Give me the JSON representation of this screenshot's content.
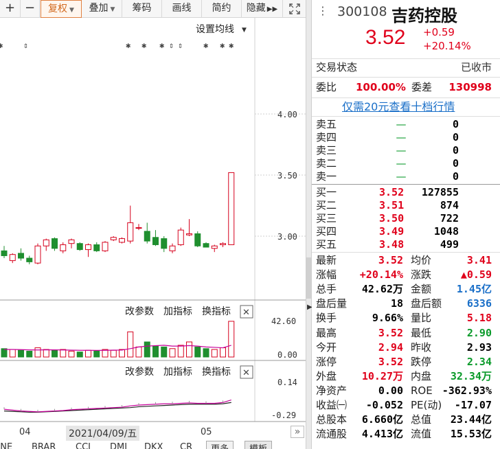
{
  "toolbar": {
    "zoom_in": "+",
    "zoom_out": "−",
    "fuquan": "复权",
    "diejia": "叠加",
    "chouma": "筹码",
    "huaxian": "画线",
    "jianyue": "简约",
    "yincang": "隐藏",
    "expand_icon": "expand-icon"
  },
  "chart": {
    "ma_setting": "设置均线",
    "price_ticks": [
      "4.00",
      "3.50",
      "3.00"
    ],
    "volume_ticks": [
      "42.60",
      "0.00"
    ],
    "indicator_ticks": [
      "0.14",
      "-0.29"
    ],
    "volume_panel_links": [
      "改参数",
      "加指标",
      "换指标"
    ],
    "indicator_panel_links": [
      "改参数",
      "加指标",
      "换指标"
    ],
    "close_glyph": "✕",
    "date_labels": [
      "04",
      "2021/04/09/五",
      "05"
    ],
    "colors": {
      "up": "#d6001c",
      "down": "#1f8f2f",
      "ma1": "#c6009a",
      "ma2": "#222222"
    }
  },
  "chart_data": {
    "type": "candlestick",
    "ylim": [
      2.55,
      4.15
    ],
    "candles": [
      {
        "o": 2.88,
        "h": 2.92,
        "l": 2.82,
        "c": 2.84
      },
      {
        "o": 2.8,
        "h": 2.86,
        "l": 2.78,
        "c": 2.85
      },
      {
        "o": 2.86,
        "h": 2.9,
        "l": 2.8,
        "c": 2.82
      },
      {
        "o": 2.82,
        "h": 2.84,
        "l": 2.77,
        "c": 2.79
      },
      {
        "o": 2.78,
        "h": 2.94,
        "l": 2.77,
        "c": 2.92
      },
      {
        "o": 2.92,
        "h": 2.98,
        "l": 2.88,
        "c": 2.97
      },
      {
        "o": 2.98,
        "h": 2.99,
        "l": 2.88,
        "c": 2.9
      },
      {
        "o": 2.88,
        "h": 2.95,
        "l": 2.86,
        "c": 2.93
      },
      {
        "o": 2.94,
        "h": 2.98,
        "l": 2.9,
        "c": 2.97
      },
      {
        "o": 2.94,
        "h": 2.95,
        "l": 2.88,
        "c": 2.89
      },
      {
        "o": 2.89,
        "h": 2.94,
        "l": 2.83,
        "c": 2.93
      },
      {
        "o": 2.93,
        "h": 2.95,
        "l": 2.87,
        "c": 2.88
      },
      {
        "o": 2.88,
        "h": 2.96,
        "l": 2.87,
        "c": 2.95
      },
      {
        "o": 2.97,
        "h": 3.0,
        "l": 2.96,
        "c": 2.99
      },
      {
        "o": 2.95,
        "h": 2.99,
        "l": 2.94,
        "c": 2.98
      },
      {
        "o": 2.96,
        "h": 3.25,
        "l": 2.94,
        "c": 3.11
      },
      {
        "o": 3.07,
        "h": 3.1,
        "l": 3.05,
        "c": 3.07
      },
      {
        "o": 3.04,
        "h": 3.11,
        "l": 2.94,
        "c": 2.96
      },
      {
        "o": 2.99,
        "h": 3.05,
        "l": 2.92,
        "c": 2.93
      },
      {
        "o": 2.98,
        "h": 3.0,
        "l": 2.87,
        "c": 2.9
      },
      {
        "o": 2.88,
        "h": 2.94,
        "l": 2.86,
        "c": 2.92
      },
      {
        "o": 2.93,
        "h": 3.07,
        "l": 2.92,
        "c": 3.05
      },
      {
        "o": 3.01,
        "h": 3.14,
        "l": 3.0,
        "c": 3.02
      },
      {
        "o": 3.02,
        "h": 3.04,
        "l": 2.91,
        "c": 2.92
      },
      {
        "o": 2.94,
        "h": 2.95,
        "l": 2.91,
        "c": 2.91
      },
      {
        "o": 2.9,
        "h": 2.93,
        "l": 2.87,
        "c": 2.92
      },
      {
        "o": 2.93,
        "h": 2.95,
        "l": 2.91,
        "c": 2.94
      },
      {
        "o": 2.93,
        "h": 3.52,
        "l": 2.93,
        "c": 3.52
      }
    ],
    "volume": {
      "ylim": [
        0,
        42.6
      ],
      "values": [
        10,
        9,
        8,
        7,
        11,
        9,
        8,
        9,
        7,
        6,
        8,
        7,
        9,
        8,
        9,
        30,
        12,
        18,
        13,
        12,
        10,
        14,
        18,
        12,
        10,
        9,
        11,
        42.62
      ],
      "ma": [
        9,
        9,
        8.8,
        8.5,
        8.4,
        8.6,
        8.5,
        8.4,
        8.2,
        8,
        8,
        7.9,
        8,
        8.2,
        8.3,
        10,
        12,
        13,
        13.5,
        14,
        13,
        13,
        13.6,
        13,
        12,
        11.5,
        11,
        14
      ]
    },
    "indicator": {
      "ylim": [
        -0.29,
        0.14
      ],
      "line1": [
        -0.21,
        -0.22,
        -0.23,
        -0.235,
        -0.24,
        -0.235,
        -0.23,
        -0.225,
        -0.215,
        -0.21,
        -0.205,
        -0.2,
        -0.195,
        -0.19,
        -0.185,
        -0.17,
        -0.16,
        -0.155,
        -0.15,
        -0.145,
        -0.145,
        -0.14,
        -0.135,
        -0.14,
        -0.14,
        -0.14,
        -0.13,
        -0.1
      ],
      "line2": [
        -0.23,
        -0.235,
        -0.24,
        -0.245,
        -0.245,
        -0.24,
        -0.235,
        -0.23,
        -0.225,
        -0.22,
        -0.215,
        -0.21,
        -0.205,
        -0.2,
        -0.195,
        -0.19,
        -0.18,
        -0.175,
        -0.17,
        -0.165,
        -0.16,
        -0.155,
        -0.15,
        -0.15,
        -0.15,
        -0.15,
        -0.145,
        -0.13
      ]
    }
  },
  "bottom_tabs": [
    "ENE",
    "BRAR",
    "CCI",
    "DMI",
    "DKX",
    "CR",
    "更多",
    "模板"
  ],
  "scroll_glyph": "»",
  "panel": {
    "code": "300108",
    "name": "吉药控股",
    "price": "3.52",
    "change": "+0.59",
    "change_pct": "+20.14%",
    "status_label": "交易状态",
    "status_value": "已收市",
    "weibi_label": "委比",
    "weibi_value": "100.00%",
    "weicha_label": "委差",
    "weicha_value": "130998",
    "upgrade_link": "仅需20元查看十档行情",
    "asks": [
      {
        "label": "卖五",
        "price": "—",
        "vol": "0"
      },
      {
        "label": "卖四",
        "price": "—",
        "vol": "0"
      },
      {
        "label": "卖三",
        "price": "—",
        "vol": "0"
      },
      {
        "label": "卖二",
        "price": "—",
        "vol": "0"
      },
      {
        "label": "卖一",
        "price": "—",
        "vol": "0"
      }
    ],
    "bids": [
      {
        "label": "买一",
        "price": "3.52",
        "vol": "127855"
      },
      {
        "label": "买二",
        "price": "3.51",
        "vol": "874"
      },
      {
        "label": "买三",
        "price": "3.50",
        "vol": "722"
      },
      {
        "label": "买四",
        "price": "3.49",
        "vol": "1048"
      },
      {
        "label": "买五",
        "price": "3.48",
        "vol": "499"
      }
    ],
    "stats": [
      {
        "l1": "最新",
        "v1": "3.52",
        "c1": "red",
        "l2": "均价",
        "v2": "3.41",
        "c2": "red"
      },
      {
        "l1": "涨幅",
        "v1": "+20.14%",
        "c1": "red",
        "l2": "涨跌",
        "v2": "▲0.59",
        "c2": "red"
      },
      {
        "l1": "总手",
        "v1": "42.62万",
        "c1": "black",
        "l2": "金额",
        "v2": "1.45亿",
        "c2": "blue"
      },
      {
        "l1": "盘后量",
        "v1": "18",
        "c1": "black",
        "l2": "盘后额",
        "v2": "6336",
        "c2": "blue"
      },
      {
        "l1": "换手",
        "v1": "9.66%",
        "c1": "black",
        "l2": "量比",
        "v2": "5.18",
        "c2": "red"
      },
      {
        "l1": "最高",
        "v1": "3.52",
        "c1": "red",
        "l2": "最低",
        "v2": "2.90",
        "c2": "green"
      },
      {
        "l1": "今开",
        "v1": "2.94",
        "c1": "red",
        "l2": "昨收",
        "v2": "2.93",
        "c2": "black"
      },
      {
        "l1": "涨停",
        "v1": "3.52",
        "c1": "red",
        "l2": "跌停",
        "v2": "2.34",
        "c2": "green"
      },
      {
        "l1": "外盘",
        "v1": "10.27万",
        "c1": "red",
        "l2": "内盘",
        "v2": "32.34万",
        "c2": "green"
      },
      {
        "l1": "净资产",
        "v1": "0.00",
        "c1": "black",
        "l2": "ROE",
        "v2": "-362.93%",
        "c2": "black"
      },
      {
        "l1": "收益㈠",
        "v1": "-0.052",
        "c1": "black",
        "l2": "PE(动)",
        "v2": "-17.07",
        "c2": "black"
      },
      {
        "l1": "总股本",
        "v1": "6.660亿",
        "c1": "black",
        "l2": "总值",
        "v2": "23.44亿",
        "c2": "black"
      },
      {
        "l1": "流通股",
        "v1": "4.413亿",
        "c1": "black",
        "l2": "流值",
        "v2": "15.53亿",
        "c2": "black"
      }
    ]
  }
}
